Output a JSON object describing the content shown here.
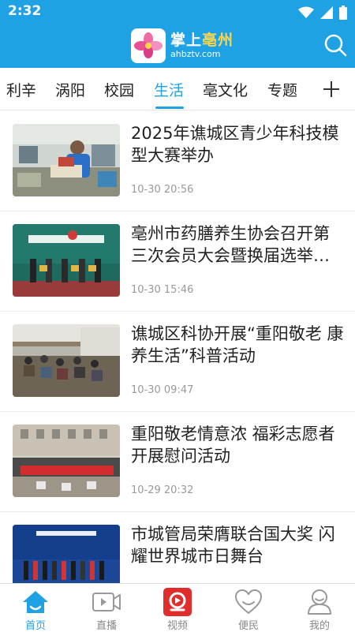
{
  "status_bar": {
    "time": "2:32"
  },
  "header": {
    "logo_title_part1": "掌上",
    "logo_title_part2": "亳州",
    "logo_subtitle": "ahbztv.com",
    "accent_color": "#1ea2e4",
    "search_icon": "search-icon"
  },
  "tabs": [
    {
      "label": "利辛"
    },
    {
      "label": "涡阳"
    },
    {
      "label": "校园"
    },
    {
      "label": "生活",
      "active": true
    },
    {
      "label": "亳文化"
    },
    {
      "label": "专题"
    }
  ],
  "news": [
    {
      "title": "2025年谯城区青少年科技模型大赛举办",
      "time": "10-30 20:56"
    },
    {
      "title": "亳州市药膳养生协会召开第三次会员大会暨换届选举大会",
      "time": "10-30 15:46"
    },
    {
      "title": "谯城区科协开展“重阳敬老 康养生活”科普活动",
      "time": "10-30 09:47"
    },
    {
      "title": "重阳敬老情意浓 福彩志愿者开展慰问活动",
      "time": "10-29 20:32"
    },
    {
      "title": "市城管局荣膺联合国大奖 闪耀世界城市日舞台",
      "time": ""
    }
  ],
  "bottom_nav": [
    {
      "label": "首页",
      "icon": "home-icon",
      "active": true
    },
    {
      "label": "直播",
      "icon": "video-icon"
    },
    {
      "label": "视频",
      "icon": "video-app-icon"
    },
    {
      "label": "便民",
      "icon": "heart-icon"
    },
    {
      "label": "我的",
      "icon": "user-icon"
    }
  ]
}
